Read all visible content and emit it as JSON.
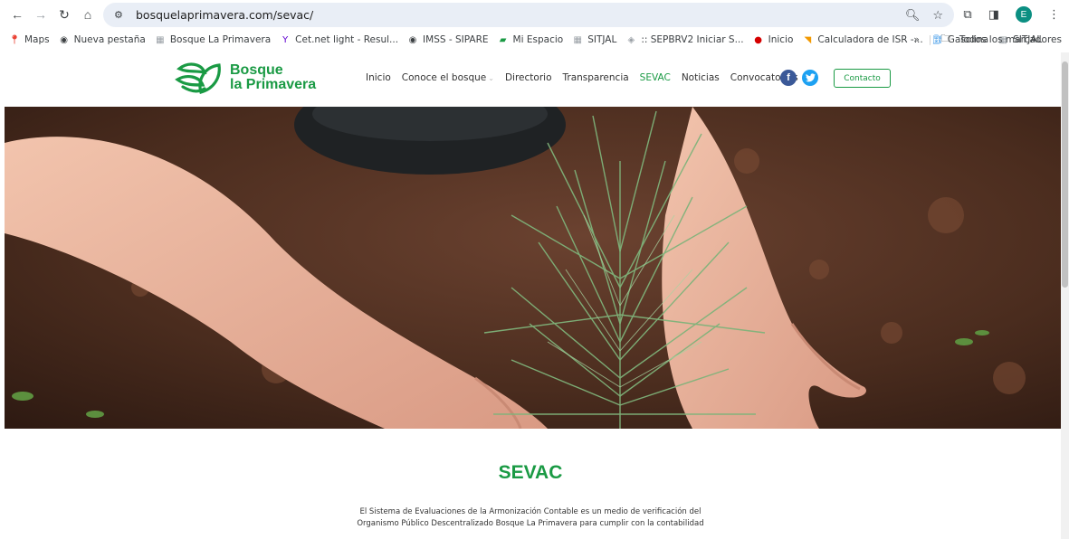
{
  "browser": {
    "url": "bosquelaprimavera.com/sevac/",
    "avatar_letter": "E",
    "bookmarks": [
      {
        "label": "Maps",
        "icon": "map-pin-icon",
        "color": "#ea4335"
      },
      {
        "label": "Nueva pestaña",
        "icon": "globe-icon",
        "color": "#3c4043"
      },
      {
        "label": "Bosque La Primavera",
        "icon": "building-icon",
        "color": "#9aa0a6"
      },
      {
        "label": "Cet.net light - Resul...",
        "icon": "yahoo-icon",
        "color": "#6001d2"
      },
      {
        "label": "IMSS - SIPARE",
        "icon": "globe-icon",
        "color": "#3c4043"
      },
      {
        "label": "Mi Espacio",
        "icon": "cfe-icon",
        "color": "#1a9a44"
      },
      {
        "label": "SITJAL",
        "icon": "building-icon",
        "color": "#9aa0a6"
      },
      {
        "label": ":: SEPBRV2 Iniciar S...",
        "icon": "shield-icon",
        "color": "#9aa0a6"
      },
      {
        "label": "Inicio",
        "icon": "dot-icon",
        "color": "#d50000"
      },
      {
        "label": "Calculadora de ISR -...",
        "icon": "flag-icon",
        "color": "#f29900"
      },
      {
        "label": "Gasolina",
        "icon": "fuel-icon",
        "color": "#1e88e5"
      },
      {
        "label": "SITJAL",
        "icon": "building-icon",
        "color": "#9aa0a6"
      }
    ],
    "all_bookmarks": "Todos los marcadores"
  },
  "site": {
    "logo_line1": "Bosque",
    "logo_line2": "la Primavera",
    "menu": [
      {
        "label": "Inicio",
        "active": false,
        "dropdown": false
      },
      {
        "label": "Conoce el bosque",
        "active": false,
        "dropdown": true
      },
      {
        "label": "Directorio",
        "active": false,
        "dropdown": false
      },
      {
        "label": "Transparencia",
        "active": false,
        "dropdown": false
      },
      {
        "label": "SEVAC",
        "active": true,
        "dropdown": false
      },
      {
        "label": "Noticias",
        "active": false,
        "dropdown": false
      },
      {
        "label": "Convocatorias",
        "active": false,
        "dropdown": false
      }
    ],
    "facebook": "f",
    "contact_button": "Contacto",
    "brand_color": "#1a9a44",
    "facebook_color": "#3b5998",
    "twitter_color": "#1da1f2"
  },
  "content": {
    "title": "SEVAC",
    "paragraph_line1": "El Sistema de Evaluaciones de la Armonización Contable es un medio de verificación del",
    "paragraph_line2": "Organismo Público Descentralizado Bosque La Primavera para cumplir con la contabilidad"
  }
}
